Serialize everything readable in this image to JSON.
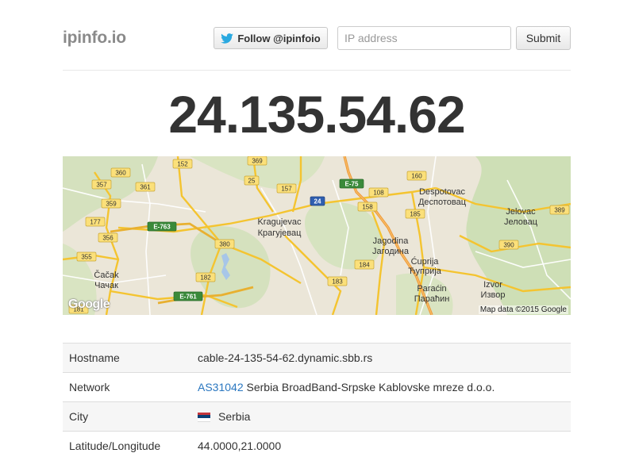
{
  "header": {
    "brand": "ipinfo.io",
    "follow_label": "Follow @ipinfoio",
    "search_placeholder": "IP address",
    "submit_label": "Submit"
  },
  "ip": "24.135.54.62",
  "map": {
    "credit": "Map data ©2015 Google",
    "logo": "Google",
    "cities": [
      {
        "latin": "Kragujevac",
        "cyrillic": "Крагујевац"
      },
      {
        "latin": "Jagodina",
        "cyrillic": "Јагодина"
      },
      {
        "latin": "Ćuprija",
        "cyrillic": "Ћуприја"
      },
      {
        "latin": "Paraćin",
        "cyrillic": "Параћин"
      },
      {
        "latin": "Čačak",
        "cyrillic": "Чачак"
      },
      {
        "latin": "Despotovac",
        "cyrillic": "Деспотовац"
      },
      {
        "latin": "Jelovac",
        "cyrillic": "Јеловац"
      },
      {
        "latin": "Izvor",
        "cyrillic": "Извор"
      }
    ],
    "road_shields": [
      "152",
      "369",
      "360",
      "357",
      "361",
      "359",
      "25",
      "157",
      "24",
      "160",
      "108",
      "158",
      "185",
      "389",
      "177",
      "356",
      "380",
      "390",
      "355",
      "182",
      "183",
      "184",
      "181",
      "E-75",
      "E-763",
      "E-761"
    ]
  },
  "details": {
    "hostname_key": "Hostname",
    "hostname": "cable-24-135-54-62.dynamic.sbb.rs",
    "network_key": "Network",
    "asn": "AS31042",
    "org": "Serbia BroadBand-Srpske Kablovske mreze d.o.o.",
    "city_key": "City",
    "country": "Serbia",
    "latlng_key": "Latitude/Longitude",
    "latlng": "44.0000,21.0000"
  },
  "colors": {
    "link": "#2a77c0",
    "twitter": "#2aa9e0",
    "road_major": "#f4c430",
    "road_motorway": "#f09a3a",
    "flag": [
      "#c6363c",
      "#0c4076",
      "#ffffff"
    ]
  }
}
